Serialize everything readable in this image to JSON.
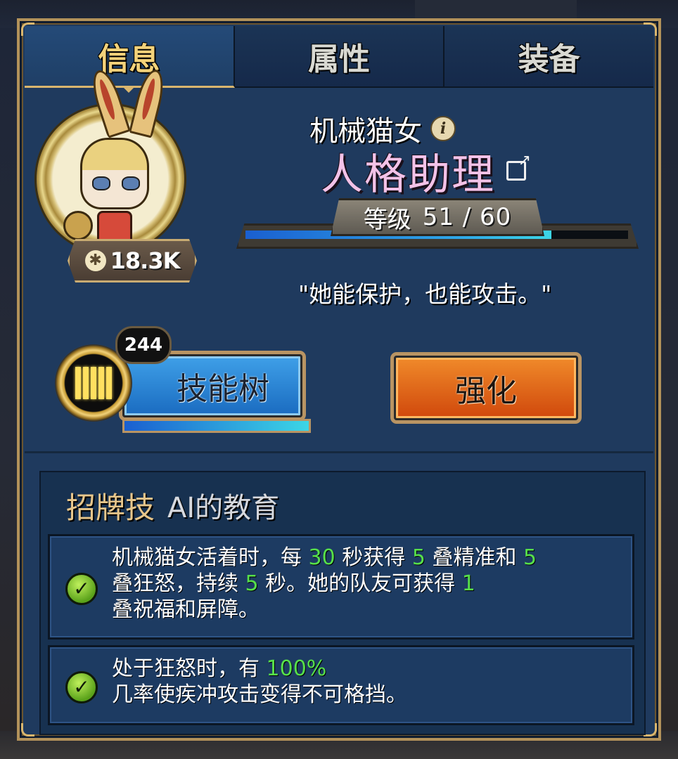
{
  "tabs": [
    {
      "label": "信息",
      "active": true
    },
    {
      "label": "属性",
      "active": false
    },
    {
      "label": "装备",
      "active": false
    }
  ],
  "hero": {
    "name": "机械猫女",
    "title": "人格助理",
    "power": "18.3K",
    "level_label": "等级",
    "level_value": "51 / 60",
    "xp_progress": 0.8,
    "quote": "\"她能保护，也能攻击。\""
  },
  "skill_tree": {
    "label": "技能树",
    "count": "244",
    "progress": 1.0
  },
  "enhance": {
    "label": "强化"
  },
  "signature": {
    "label": "招牌技",
    "name": "AI的教育",
    "entries": [
      {
        "parts": [
          "机械猫女活着时，每 ",
          "30",
          " 秒获得 ",
          "5",
          " 叠精准和 ",
          "5",
          "叠狂怒，持续 ",
          "5",
          " 秒。她的队友可获得 ",
          "1",
          "叠祝福和屏障。"
        ]
      },
      {
        "parts": [
          "处于狂怒时，有 ",
          "100%",
          "几率使疾冲攻击变得不可格挡。"
        ]
      }
    ]
  },
  "colors": {
    "highlight": "#57e04a",
    "title_pink": "#f3c2e8",
    "gold": "#d9b66e",
    "panel_blue": "#1f3a5e"
  },
  "icons": [
    "info-icon",
    "external-link-icon",
    "power-icon",
    "skill-tree-medal-icon",
    "check-icon"
  ]
}
